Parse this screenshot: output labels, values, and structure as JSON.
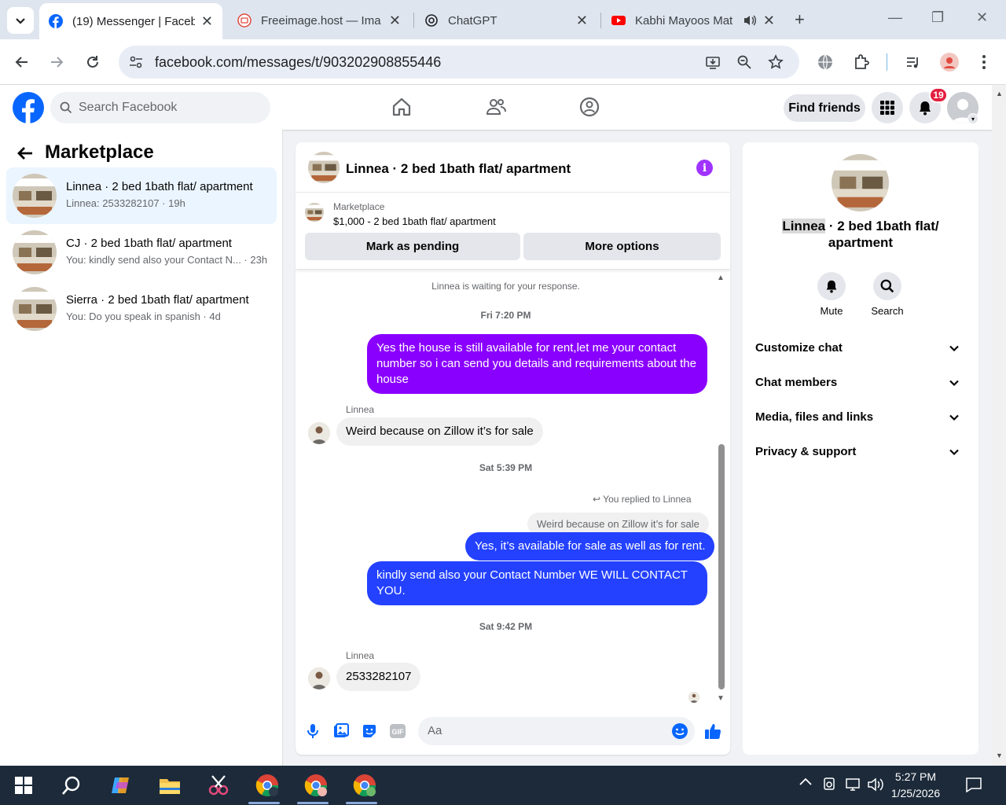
{
  "browser": {
    "tabs": [
      {
        "label": "(19) Messenger | Faceb",
        "active": true
      },
      {
        "label": "Freeimage.host — Ima"
      },
      {
        "label": "ChatGPT"
      },
      {
        "label": "Kabhi Mayoos Mat"
      }
    ],
    "url": "facebook.com/messages/t/903202908855446"
  },
  "fb": {
    "search_placeholder": "Search Facebook",
    "find_friends": "Find friends",
    "notification_count": "19"
  },
  "left": {
    "title": "Marketplace",
    "conversations": [
      {
        "name": "Linnea · 2 bed 1bath flat/ apartment",
        "preview": "Linnea: 2533282107 · 19h"
      },
      {
        "name": "CJ · 2 bed 1bath flat/ apartment",
        "preview": "You: kindly send also your Contact N... · 23h"
      },
      {
        "name": "Sierra · 2 bed 1bath flat/ apartment",
        "preview": "You: Do you speak in spanish · 4d"
      }
    ]
  },
  "chat": {
    "title": "Linnea · 2 bed 1bath flat/ apartment",
    "marketplace_label": "Marketplace",
    "marketplace_item": "$1,000 - 2 bed 1bath flat/ apartment",
    "mark_pending": "Mark as pending",
    "more_options": "More options",
    "waiting": "Linnea is waiting for your response.",
    "ts1": "Fri 7:20 PM",
    "msg1": "Yes the house is still available for rent,let me your contact number so i can send you details and requirements about the house",
    "sender1": "Linnea",
    "msg2": "Weird because on Zillow it’s for sale",
    "ts2": "Sat 5:39 PM",
    "reply_note": "You replied to Linnea",
    "quoted": "Weird because on Zillow it’s for sale",
    "msg3": "Yes, it’s available for sale as well as for rent.",
    "msg4": "kindly send also your Contact Number  WE WILL CONTACT YOU.",
    "ts3": "Sat 9:42 PM",
    "sender2": "Linnea",
    "msg5": "2533282107",
    "composer_placeholder": "Aa"
  },
  "right": {
    "name_first": "Linnea",
    "name_rest": " · 2 bed 1bath flat/ apartment",
    "mute": "Mute",
    "search": "Search",
    "sections": [
      "Customize chat",
      "Chat members",
      "Media, files and links",
      "Privacy & support"
    ]
  },
  "taskbar": {
    "time": "5:27 PM",
    "date": "1/25/2026"
  }
}
